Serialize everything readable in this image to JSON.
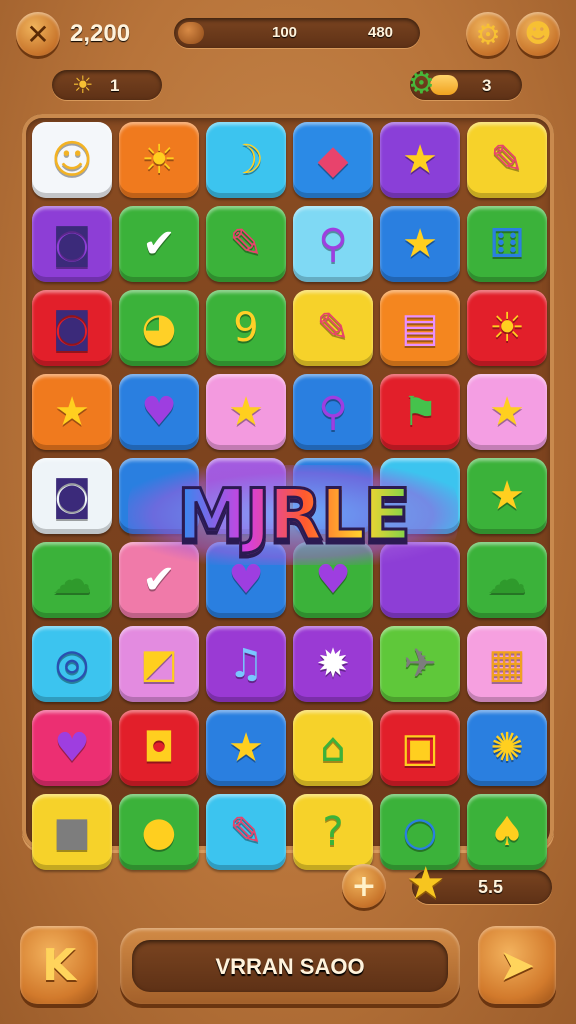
{
  "hud": {
    "close_icon": "x-icon",
    "score": "2,200",
    "progress_left": "100",
    "progress_right": "480",
    "progress_fraction": 0.08,
    "settings_icon": "gear-icon",
    "profile_icon": "smiley-icon"
  },
  "resources": {
    "lives": "1",
    "gems": "3"
  },
  "board": {
    "banner": "MJRLE",
    "tiles": [
      {
        "color": "#f4f7fa",
        "icon": "sun-face"
      },
      {
        "color": "#f07a1e",
        "icon": "sun"
      },
      {
        "color": "#3cc4ef",
        "icon": "banana"
      },
      {
        "color": "#2b8ae6",
        "icon": "kite"
      },
      {
        "color": "#8a3fd8",
        "icon": "star"
      },
      {
        "color": "#f6d22a",
        "icon": "pencil"
      },
      {
        "color": "#8d3ed6",
        "icon": "camera"
      },
      {
        "color": "#3bb23a",
        "icon": "check"
      },
      {
        "color": "#3bb23a",
        "icon": "pencil"
      },
      {
        "color": "#7fd9f4",
        "icon": "magnifier"
      },
      {
        "color": "#2a7fe0",
        "icon": "star"
      },
      {
        "color": "#3bb23a",
        "icon": "dice"
      },
      {
        "color": "#e21f2a",
        "icon": "camera"
      },
      {
        "color": "#3bb23a",
        "icon": "pin"
      },
      {
        "color": "#3bb23a",
        "icon": "nine"
      },
      {
        "color": "#f6d22a",
        "icon": "pencil"
      },
      {
        "color": "#f4861f",
        "icon": "note"
      },
      {
        "color": "#e21f2a",
        "icon": "sun"
      },
      {
        "color": "#f07a1e",
        "icon": "star"
      },
      {
        "color": "#2a7fe0",
        "icon": "heart"
      },
      {
        "color": "#f39adf",
        "icon": "star"
      },
      {
        "color": "#2a7fe0",
        "icon": "magnifier"
      },
      {
        "color": "#e21f2a",
        "icon": "flag"
      },
      {
        "color": "#f49ee3",
        "icon": "star"
      },
      {
        "color": "#eef4f8",
        "icon": "camera"
      },
      {
        "color": "#2a7fe0",
        "icon": "blank"
      },
      {
        "color": "#a35be0",
        "icon": "blank"
      },
      {
        "color": "#2a7fe0",
        "icon": "blank"
      },
      {
        "color": "#3cc4ef",
        "icon": "blank"
      },
      {
        "color": "#3bb23a",
        "icon": "star"
      },
      {
        "color": "#3bb23a",
        "icon": "cloud"
      },
      {
        "color": "#f07aa9",
        "icon": "check"
      },
      {
        "color": "#2a7fe0",
        "icon": "heart"
      },
      {
        "color": "#3bb23a",
        "icon": "heart"
      },
      {
        "color": "#8d3ed6",
        "icon": "blank"
      },
      {
        "color": "#3bb23a",
        "icon": "cloud"
      },
      {
        "color": "#3cc4ef",
        "icon": "target"
      },
      {
        "color": "#e38be0",
        "icon": "tag"
      },
      {
        "color": "#9a3ad4",
        "icon": "music"
      },
      {
        "color": "#9a3ad4",
        "icon": "splash"
      },
      {
        "color": "#5fc83a",
        "icon": "satellite"
      },
      {
        "color": "#f6a0e0",
        "icon": "calendar"
      },
      {
        "color": "#ec2f72",
        "icon": "heart"
      },
      {
        "color": "#e21f2a",
        "icon": "bag"
      },
      {
        "color": "#2a7fe0",
        "icon": "star"
      },
      {
        "color": "#f6d22a",
        "icon": "shop"
      },
      {
        "color": "#e21f2a",
        "icon": "box"
      },
      {
        "color": "#2a7fe0",
        "icon": "cookie"
      },
      {
        "color": "#f6d22a",
        "icon": "cube"
      },
      {
        "color": "#3bb23a",
        "icon": "balloon"
      },
      {
        "color": "#3cc4ef",
        "icon": "pencil"
      },
      {
        "color": "#f6d22a",
        "icon": "question"
      },
      {
        "color": "#3bb23a",
        "icon": "search"
      },
      {
        "color": "#3bb23a",
        "icon": "icecream"
      }
    ]
  },
  "footer": {
    "add_icon": "plus-icon",
    "stars": "5.5",
    "back_icon": "k-icon",
    "action_label": "VRRAN SAOO",
    "next_icon": "arrow-right-icon"
  }
}
